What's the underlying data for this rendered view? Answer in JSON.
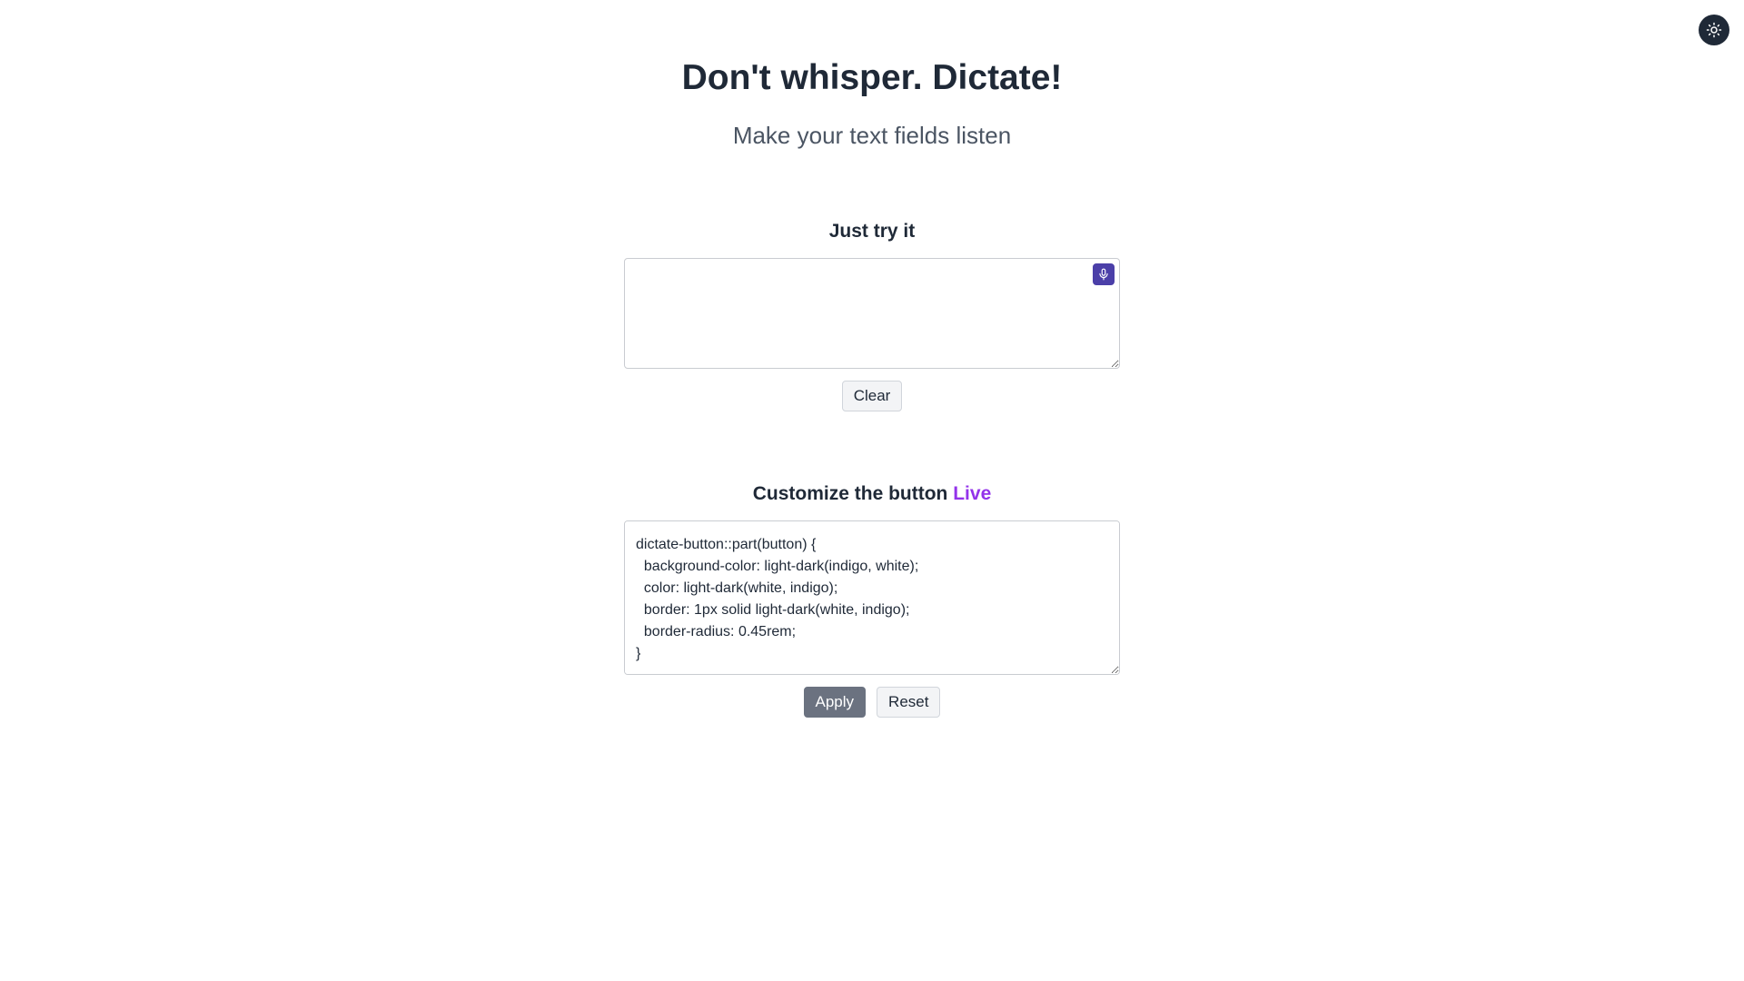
{
  "header": {
    "title": "Don't whisper. Dictate!",
    "subtitle": "Make your text fields listen",
    "theme_toggle_icon": "sun-icon"
  },
  "try_section": {
    "heading": "Just try it",
    "input_value": "",
    "dictate_icon": "microphone-icon",
    "dictate_color": "#4b3fa8",
    "clear_label": "Clear"
  },
  "customize_section": {
    "heading": "Customize the button",
    "live_label": "Live",
    "live_color": "#9333ea",
    "css_value": "dictate-button::part(button) {\n  background-color: light-dark(indigo, white);\n  color: light-dark(white, indigo);\n  border: 1px solid light-dark(white, indigo);\n  border-radius: 0.45rem;\n}",
    "apply_label": "Apply",
    "reset_label": "Reset"
  }
}
